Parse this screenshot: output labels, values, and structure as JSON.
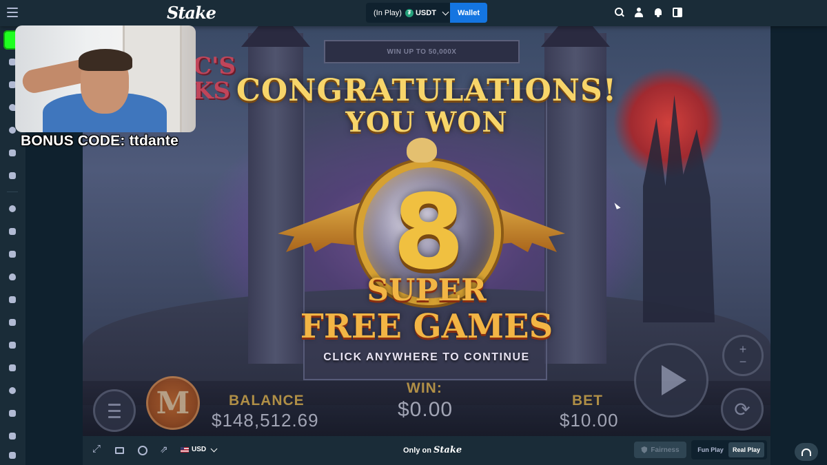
{
  "topbar": {
    "logo": "Stake",
    "balance_status": "(In Play)",
    "currency": "USDT",
    "currency_icon": "tether-icon",
    "wallet_label": "Wallet",
    "accent": "#1475e1"
  },
  "webcam": {
    "bonus_text": "BONUS CODE: ttdante"
  },
  "game": {
    "win_up": "WIN UP TO 50,000X",
    "logo_fragment": "C'S\nKS",
    "popup_line1": "CONGRATULATIONS!",
    "popup_line2": "YOU WON",
    "count": "8",
    "super_line1": "SUPER",
    "super_line2": "FREE GAMES",
    "continue": "CLICK ANYWHERE TO CONTINUE",
    "balance_label": "BALANCE",
    "balance_value": "$148,512.69",
    "win_label": "WIN:",
    "win_value": "$0.00",
    "bet_label": "BET",
    "bet_value": "$10.00",
    "coin_letter": "M"
  },
  "bottombar": {
    "currency": "USD",
    "only_on_prefix": "Only on",
    "only_on_brand": "Stake",
    "fairness": "Fairness",
    "fun_play": "Fun Play",
    "real_play": "Real Play"
  }
}
